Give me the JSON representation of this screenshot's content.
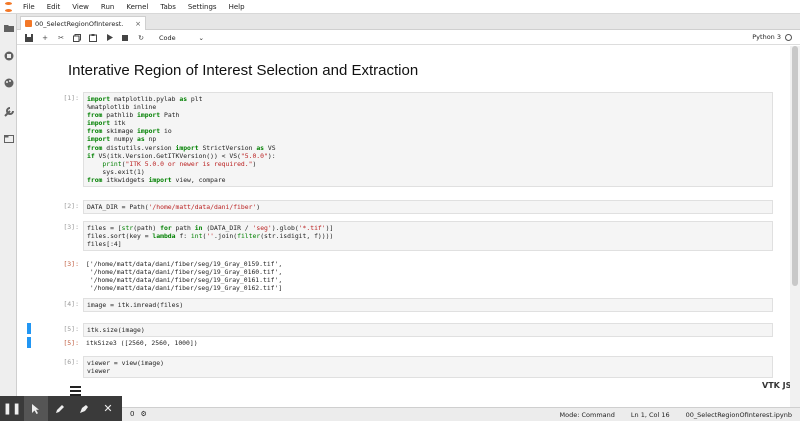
{
  "menu": {
    "items": [
      "File",
      "Edit",
      "View",
      "Run",
      "Kernel",
      "Tabs",
      "Settings",
      "Help"
    ]
  },
  "tab": {
    "label": "00_SelectRegionOfInterest.",
    "close": "×"
  },
  "toolbar": {
    "cell_type": "Code",
    "kernel": "Python 3"
  },
  "notebook": {
    "title": "Interative Region of Interest Selection and Extraction",
    "cells": [
      {
        "prompt": "[1]:",
        "lines": [
          "import matplotlib.pylab as plt",
          "%matplotlib inline",
          "from pathlib import Path",
          "import itk",
          "from skimage import io",
          "import numpy as np",
          "from distutils.version import StrictVersion as VS",
          "if VS(itk.Version.GetITKVersion()) < VS(\"5.0.0\"):",
          "    print(\"ITK 5.0.0 or newer is required.\")",
          "    sys.exit(1)",
          "from itkwidgets import view, compare"
        ]
      },
      {
        "prompt": "[2]:",
        "lines": [
          "DATA_DIR = Path('/home/matt/data/dani/fiber')"
        ]
      },
      {
        "prompt": "[3]:",
        "lines": [
          "files = [str(path) for path in (DATA_DIR / 'seg').glob('*.tif')]",
          "files.sort(key = lambda f: int(''.join(filter(str.isdigit, f))))",
          "files[:4]"
        ]
      },
      {
        "prompt": "[3]:",
        "out": true,
        "lines": [
          "['/home/matt/data/dani/fiber/seg/19_Gray_0159.tif',",
          " '/home/matt/data/dani/fiber/seg/19_Gray_0160.tif',",
          " '/home/matt/data/dani/fiber/seg/19_Gray_0161.tif',",
          " '/home/matt/data/dani/fiber/seg/19_Gray_0162.tif']"
        ]
      },
      {
        "prompt": "[4]:",
        "lines": [
          "image = itk.imread(files)"
        ]
      },
      {
        "prompt": "[5]:",
        "lines": [
          "itk.size(image)"
        ]
      },
      {
        "prompt": "[5]:",
        "out": true,
        "lines": [
          "itkSize3 ([2560, 2560, 1000])"
        ]
      },
      {
        "prompt": "[6]:",
        "lines": [
          "viewer = view(image)",
          "viewer"
        ]
      }
    ]
  },
  "status": {
    "mode": "Mode: Command",
    "position": "Ln 1, Col 16",
    "file": "00_SelectRegionOfInterest.ipynb",
    "count": "0",
    "gear": "⚙"
  },
  "widget": {
    "logo": "VTK JS"
  },
  "colors": {
    "accent": "#2196f3",
    "orange": "#f37726",
    "output_prompt": "#bf5b3d"
  }
}
